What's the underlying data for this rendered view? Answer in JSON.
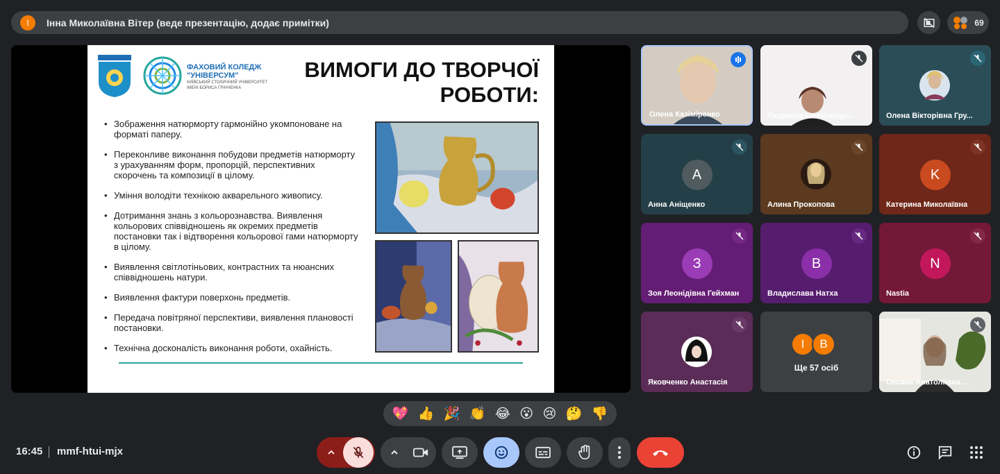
{
  "topbar": {
    "presenter_initial": "І",
    "presenter_text": "Інна Миколаївна Вітер (веде презентацію, додає примітки)",
    "participant_count": "69"
  },
  "slide": {
    "college_line1": "ФАХОВИЙ КОЛЕДЖ",
    "college_line2": "\"УНІВЕРСУМ\"",
    "college_line3": "КИЇВСЬКИЙ СТОЛИЧНИЙ УНІВЕРСИТЕТ",
    "college_line4": "ІМЕНІ БОРИСА ГРІНЧЕНКА",
    "title_line1": "ВИМОГИ ДО ТВОРЧОЇ",
    "title_line2": "РОБОТИ:",
    "requirements": [
      "Зображення натюрморту гармонійно укомпоноване на форматі паперу.",
      "Переконливе виконання побудови предметів натюрморту з урахуванням форм, пропорцій, перспективних скорочень та композиції в цілому.",
      "Уміння володіти технікою акварельного живопису.",
      "Дотримання знань з кольорознавства. Виявлення кольорових співвідношень як окремих предметів постановки так і відтворення кольорової гами натюрморту в цілому.",
      "Виявлення світлотіньових, контрастних та нюансних співвідношень натури.",
      "Виявлення фактури поверхонь предметів.",
      "Передача повітряної перспективи, виявлення плановості постановки.",
      "Технічна досконалість виконання роботи, охайність."
    ]
  },
  "participants": [
    {
      "name": "Олена Казіміренко",
      "type": "video",
      "state": "speaking"
    },
    {
      "name": "Людмила Олександрі...",
      "type": "video",
      "state": "muted"
    },
    {
      "name": "Олена Вікторівна Гру...",
      "type": "photo",
      "state": "muted"
    },
    {
      "name": "Анна Аніщенко",
      "type": "letter",
      "letter": "A",
      "bg": "#2c4a52",
      "avatar_bg": "#4f5b5f",
      "state": "muted"
    },
    {
      "name": "Алина Прокопова",
      "type": "photo",
      "bg": "#5d3b1e",
      "state": "muted"
    },
    {
      "name": "Катерина Миколаївна",
      "type": "letter",
      "letter": "K",
      "bg": "#7a2a1c",
      "avatar_bg": "#c94a1f",
      "state": "muted"
    },
    {
      "name": "Зоя Леонідівна Гейхман",
      "type": "letter",
      "letter": "З",
      "bg": "#6a1f7a",
      "avatar_bg": "#9b3cb7",
      "state": "muted"
    },
    {
      "name": "Владислава Натха",
      "type": "letter",
      "letter": "B",
      "bg": "#591f72",
      "avatar_bg": "#8a2fa8",
      "state": "muted"
    },
    {
      "name": "Nastia",
      "type": "letter",
      "letter": "N",
      "bg": "#7a1a3c",
      "avatar_bg": "#c2185b",
      "state": "muted"
    },
    {
      "name": "Яковченко Анастасія",
      "type": "photo",
      "bg": "#5e2e5b",
      "state": "muted"
    },
    {
      "name": "Ще 57 осіб",
      "type": "more",
      "letters": [
        "І",
        "В"
      ],
      "bg": "#3c4043"
    },
    {
      "name": "Оксана Анатоліївна ...",
      "type": "video",
      "state": "muted"
    }
  ],
  "reactions": [
    "💖",
    "👍",
    "🎉",
    "👏",
    "😂",
    "😮",
    "😢",
    "🤔",
    "👎"
  ],
  "bottom": {
    "time": "16:45",
    "meeting_code": "mmf-htui-mjx"
  },
  "colors": {
    "background": "#202124",
    "surface": "#3c4043",
    "mic_off_bg": "#f9dedc",
    "accent_blue": "#a8c7fa",
    "end_call_red": "#ea4335"
  }
}
